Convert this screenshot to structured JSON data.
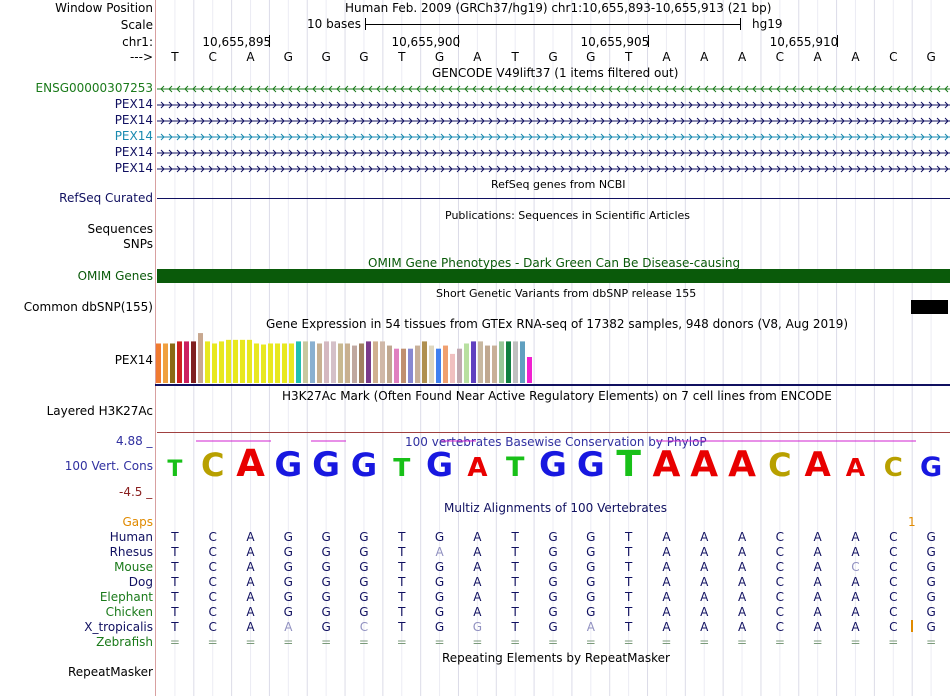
{
  "header": {
    "window_position_label": "Window Position",
    "window_position_value": "Human Feb. 2009 (GRCh37/hg19)   chr1:10,655,893-10,655,913 (21 bp)",
    "scale_label": "Scale",
    "scale_text": "10 bases",
    "assembly": "hg19",
    "chrom_label": "chr1:",
    "strand_label": "--->",
    "coords": [
      "10,655,895",
      "10,655,900",
      "10,655,905",
      "10,655,910"
    ]
  },
  "bases": [
    "T",
    "C",
    "A",
    "G",
    "G",
    "G",
    "T",
    "G",
    "A",
    "T",
    "G",
    "G",
    "T",
    "A",
    "A",
    "A",
    "C",
    "A",
    "A",
    "C",
    "G"
  ],
  "tracks": {
    "gencode": {
      "title": "GENCODE V49lift37 (1 items filtered out)",
      "rows": [
        {
          "label": "ENSG00000307253",
          "color": "#1a7a1a",
          "dir": "left"
        },
        {
          "label": "PEX14",
          "color": "#101060",
          "dir": "right"
        },
        {
          "label": "PEX14",
          "color": "#101060",
          "dir": "right"
        },
        {
          "label": "PEX14",
          "color": "#1a8ab0",
          "dir": "right"
        },
        {
          "label": "PEX14",
          "color": "#101060",
          "dir": "right"
        },
        {
          "label": "PEX14",
          "color": "#101060",
          "dir": "right"
        }
      ]
    },
    "refseq": {
      "title": "RefSeq genes from NCBI",
      "label": "RefSeq Curated"
    },
    "publications": {
      "title": "Publications: Sequences in Scientific Articles",
      "label": "Sequences"
    },
    "snps": {
      "label": "SNPs"
    },
    "omim": {
      "title": "OMIM Gene Phenotypes - Dark Green Can Be Disease-causing",
      "label": "OMIM Genes",
      "color": "#0a5a0a"
    },
    "dbsnp": {
      "title": "Short Genetic Variants from dbSNP release 155",
      "label": "Common dbSNP(155)"
    },
    "gtex": {
      "title": "Gene Expression in 54 tissues from GTEx RNA-seq of 17382 samples, 948 donors (V8, Aug 2019)",
      "label": "PEX14"
    },
    "h3k27ac": {
      "title": "H3K27Ac Mark (Often Found Near Active Regulatory Elements) on 7 cell lines from ENCODE",
      "label": "Layered H3K27Ac"
    },
    "conservation": {
      "title": "100 vertebrates Basewise Conservation by PhyloP",
      "label": "100 Vert. Cons",
      "ymax": "4.88 _",
      "ymin": "-4.5 _"
    },
    "multiz": {
      "title": "Multiz Alignments of 100 Vertebrates",
      "gaps_label": "Gaps",
      "gap_count": "1",
      "species": [
        {
          "name": "Human",
          "color": "#101060",
          "seq": "TCAGGGTGATGGTAAACAACG",
          "light": []
        },
        {
          "name": "Rhesus",
          "color": "#101060",
          "seq": "TCAGGGTAATGGTAAACAACG",
          "light": [
            7
          ]
        },
        {
          "name": "Mouse",
          "color": "#1a7a1a",
          "seq": "TCAGGGTGATGGTAAACACCG",
          "light": [
            18
          ]
        },
        {
          "name": "Dog",
          "color": "#101060",
          "seq": "TCAGGGTGATGGTAAACAACG",
          "light": []
        },
        {
          "name": "Elephant",
          "color": "#1a7a1a",
          "seq": "TCAGGGTGATGGTAAACAACG",
          "light": []
        },
        {
          "name": "Chicken",
          "color": "#1a7a1a",
          "seq": "TCAGGGTGATGGTAAACAACG",
          "light": []
        },
        {
          "name": "X_tropicalis",
          "color": "#101060",
          "seq": "TCAAGCTGGTGATAAACAACG",
          "light": [
            3,
            5,
            8,
            11
          ]
        },
        {
          "name": "Zebrafish",
          "color": "#1a7a1a",
          "seq": "=====================",
          "light": [
            0,
            1,
            2,
            3,
            4,
            5,
            6,
            7,
            8,
            9,
            10,
            11,
            12,
            13,
            14,
            15,
            16,
            17,
            18,
            19,
            20
          ]
        }
      ]
    },
    "repeatmasker": {
      "title": "Repeating Elements by RepeatMasker",
      "label": "RepeatMasker"
    }
  },
  "colors": {
    "nav_blue": "#101060",
    "dark_green": "#1a7a1a",
    "conservation_label": "#3030a0",
    "gaps_orange": "#e08a00",
    "base_A": "#e80000",
    "base_C": "#b8a000",
    "base_G": "#1818e0",
    "base_T": "#18c018"
  },
  "chart_data": {
    "type": "bar",
    "title": "Gene Expression in 54 tissues from GTEx RNA-seq of 17382 samples, 948 donors (V8, Aug 2019)",
    "bars": [
      {
        "v": 0.76,
        "c": "#f07a30"
      },
      {
        "v": 0.76,
        "c": "#f0a040"
      },
      {
        "v": 0.76,
        "c": "#8b6914"
      },
      {
        "v": 0.8,
        "c": "#cc2020"
      },
      {
        "v": 0.8,
        "c": "#cc2060"
      },
      {
        "v": 0.8,
        "c": "#802020"
      },
      {
        "v": 0.96,
        "c": "#c8a890"
      },
      {
        "v": 0.8,
        "c": "#e8e820"
      },
      {
        "v": 0.76,
        "c": "#e8e820"
      },
      {
        "v": 0.8,
        "c": "#e8e820"
      },
      {
        "v": 0.83,
        "c": "#e8e820"
      },
      {
        "v": 0.83,
        "c": "#e8e820"
      },
      {
        "v": 0.83,
        "c": "#e8e820"
      },
      {
        "v": 0.83,
        "c": "#e8e820"
      },
      {
        "v": 0.76,
        "c": "#e8e820"
      },
      {
        "v": 0.74,
        "c": "#e8e820"
      },
      {
        "v": 0.76,
        "c": "#e8e820"
      },
      {
        "v": 0.76,
        "c": "#e8e820"
      },
      {
        "v": 0.76,
        "c": "#e8e820"
      },
      {
        "v": 0.76,
        "c": "#e8e820"
      },
      {
        "v": 0.8,
        "c": "#20c0b0"
      },
      {
        "v": 0.8,
        "c": "#c8c8a0"
      },
      {
        "v": 0.8,
        "c": "#8ab0d0"
      },
      {
        "v": 0.76,
        "c": "#c8b090"
      },
      {
        "v": 0.8,
        "c": "#d4b8c0"
      },
      {
        "v": 0.8,
        "c": "#d4c0c8"
      },
      {
        "v": 0.76,
        "c": "#c8b890"
      },
      {
        "v": 0.76,
        "c": "#c8b090"
      },
      {
        "v": 0.72,
        "c": "#c0a8a0"
      },
      {
        "v": 0.76,
        "c": "#a08060"
      },
      {
        "v": 0.8,
        "c": "#7a3a8a"
      },
      {
        "v": 0.8,
        "c": "#d0b090"
      },
      {
        "v": 0.8,
        "c": "#d0b8a8"
      },
      {
        "v": 0.72,
        "c": "#c0a890"
      },
      {
        "v": 0.66,
        "c": "#e080c0"
      },
      {
        "v": 0.66,
        "c": "#c09070"
      },
      {
        "v": 0.66,
        "c": "#8888d0"
      },
      {
        "v": 0.72,
        "c": "#c8b098"
      },
      {
        "v": 0.8,
        "c": "#b09050"
      },
      {
        "v": 0.72,
        "c": "#e0d8c0"
      },
      {
        "v": 0.66,
        "c": "#4080f0"
      },
      {
        "v": 0.72,
        "c": "#f0a070"
      },
      {
        "v": 0.56,
        "c": "#f0c0c0"
      },
      {
        "v": 0.66,
        "c": "#c0a8b0"
      },
      {
        "v": 0.76,
        "c": "#b8e0a0"
      },
      {
        "v": 0.8,
        "c": "#6040c0"
      },
      {
        "v": 0.8,
        "c": "#c8b8a0"
      },
      {
        "v": 0.72,
        "c": "#c0a890"
      },
      {
        "v": 0.72,
        "c": "#c8b098"
      },
      {
        "v": 0.8,
        "c": "#98c898"
      },
      {
        "v": 0.8,
        "c": "#108040"
      },
      {
        "v": 0.8,
        "c": "#c0c0c0"
      },
      {
        "v": 0.8,
        "c": "#60a0c0"
      },
      {
        "v": 0.5,
        "c": "#f020d0"
      }
    ]
  },
  "conservation_data": {
    "sizes": [
      0.35,
      0.75,
      0.95,
      0.85,
      0.85,
      0.75,
      0.45,
      0.8,
      0.5,
      0.55,
      0.85,
      0.85,
      0.9,
      0.9,
      0.9,
      0.9,
      0.75,
      0.85,
      0.45,
      0.5,
      0.55
    ]
  }
}
